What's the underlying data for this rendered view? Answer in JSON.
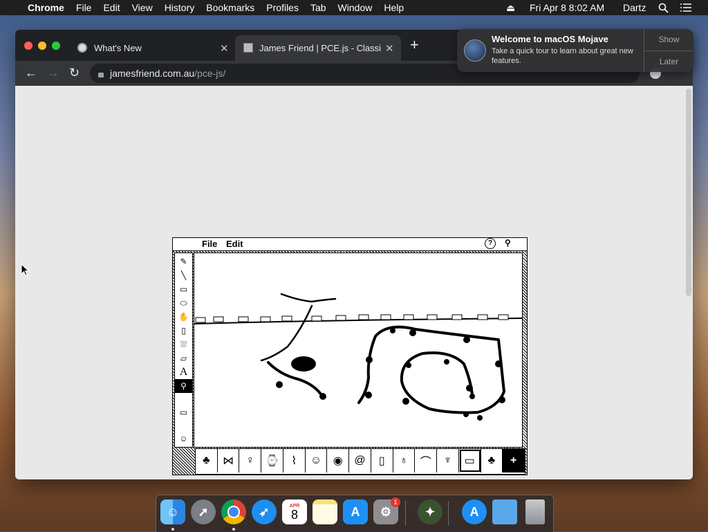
{
  "menubar": {
    "app": "Chrome",
    "items": [
      "File",
      "Edit",
      "View",
      "History",
      "Bookmarks",
      "Profiles",
      "Tab",
      "Window",
      "Help"
    ],
    "clock": "Fri Apr 8  8:02 AM",
    "user": "Dartz"
  },
  "browser": {
    "tabs": [
      {
        "title": "What's New"
      },
      {
        "title": "James Friend | PCE.js - Classic"
      }
    ],
    "url_host": "jamesfriend.com.au",
    "url_path": "/pce-js/"
  },
  "emulator": {
    "menu": [
      "File",
      "Edit"
    ],
    "tools": [
      "pencil",
      "line",
      "rectangle",
      "oval",
      "lasso",
      "spray-can",
      "paint-bucket",
      "eraser",
      "text",
      "stamp"
    ],
    "tool_text_label": "A",
    "patterns": [
      "pineapple",
      "bow",
      "bulb",
      "watch",
      "bird",
      "face",
      "eye",
      "snail",
      "bottle",
      "pear",
      "duck",
      "tree",
      "truck",
      "clover",
      "cross"
    ]
  },
  "notification": {
    "title": "Welcome to macOS Mojave",
    "body": "Take a quick tour to learn about great new features.",
    "show": "Show",
    "later": "Later"
  },
  "dock": {
    "apps": [
      "Finder",
      "Launchpad",
      "Google Chrome",
      "Safari",
      "Calendar",
      "Notes",
      "App Store",
      "System Preferences",
      "Utility",
      "App Store",
      "Folder",
      "Trash"
    ],
    "calendar_month": "APR",
    "calendar_day": "8",
    "badge": "1"
  },
  "colors": {
    "menubar": "#1f1f21",
    "tabbar": "#202124",
    "toolbar": "#35363a",
    "page": "#e8e8e8"
  }
}
